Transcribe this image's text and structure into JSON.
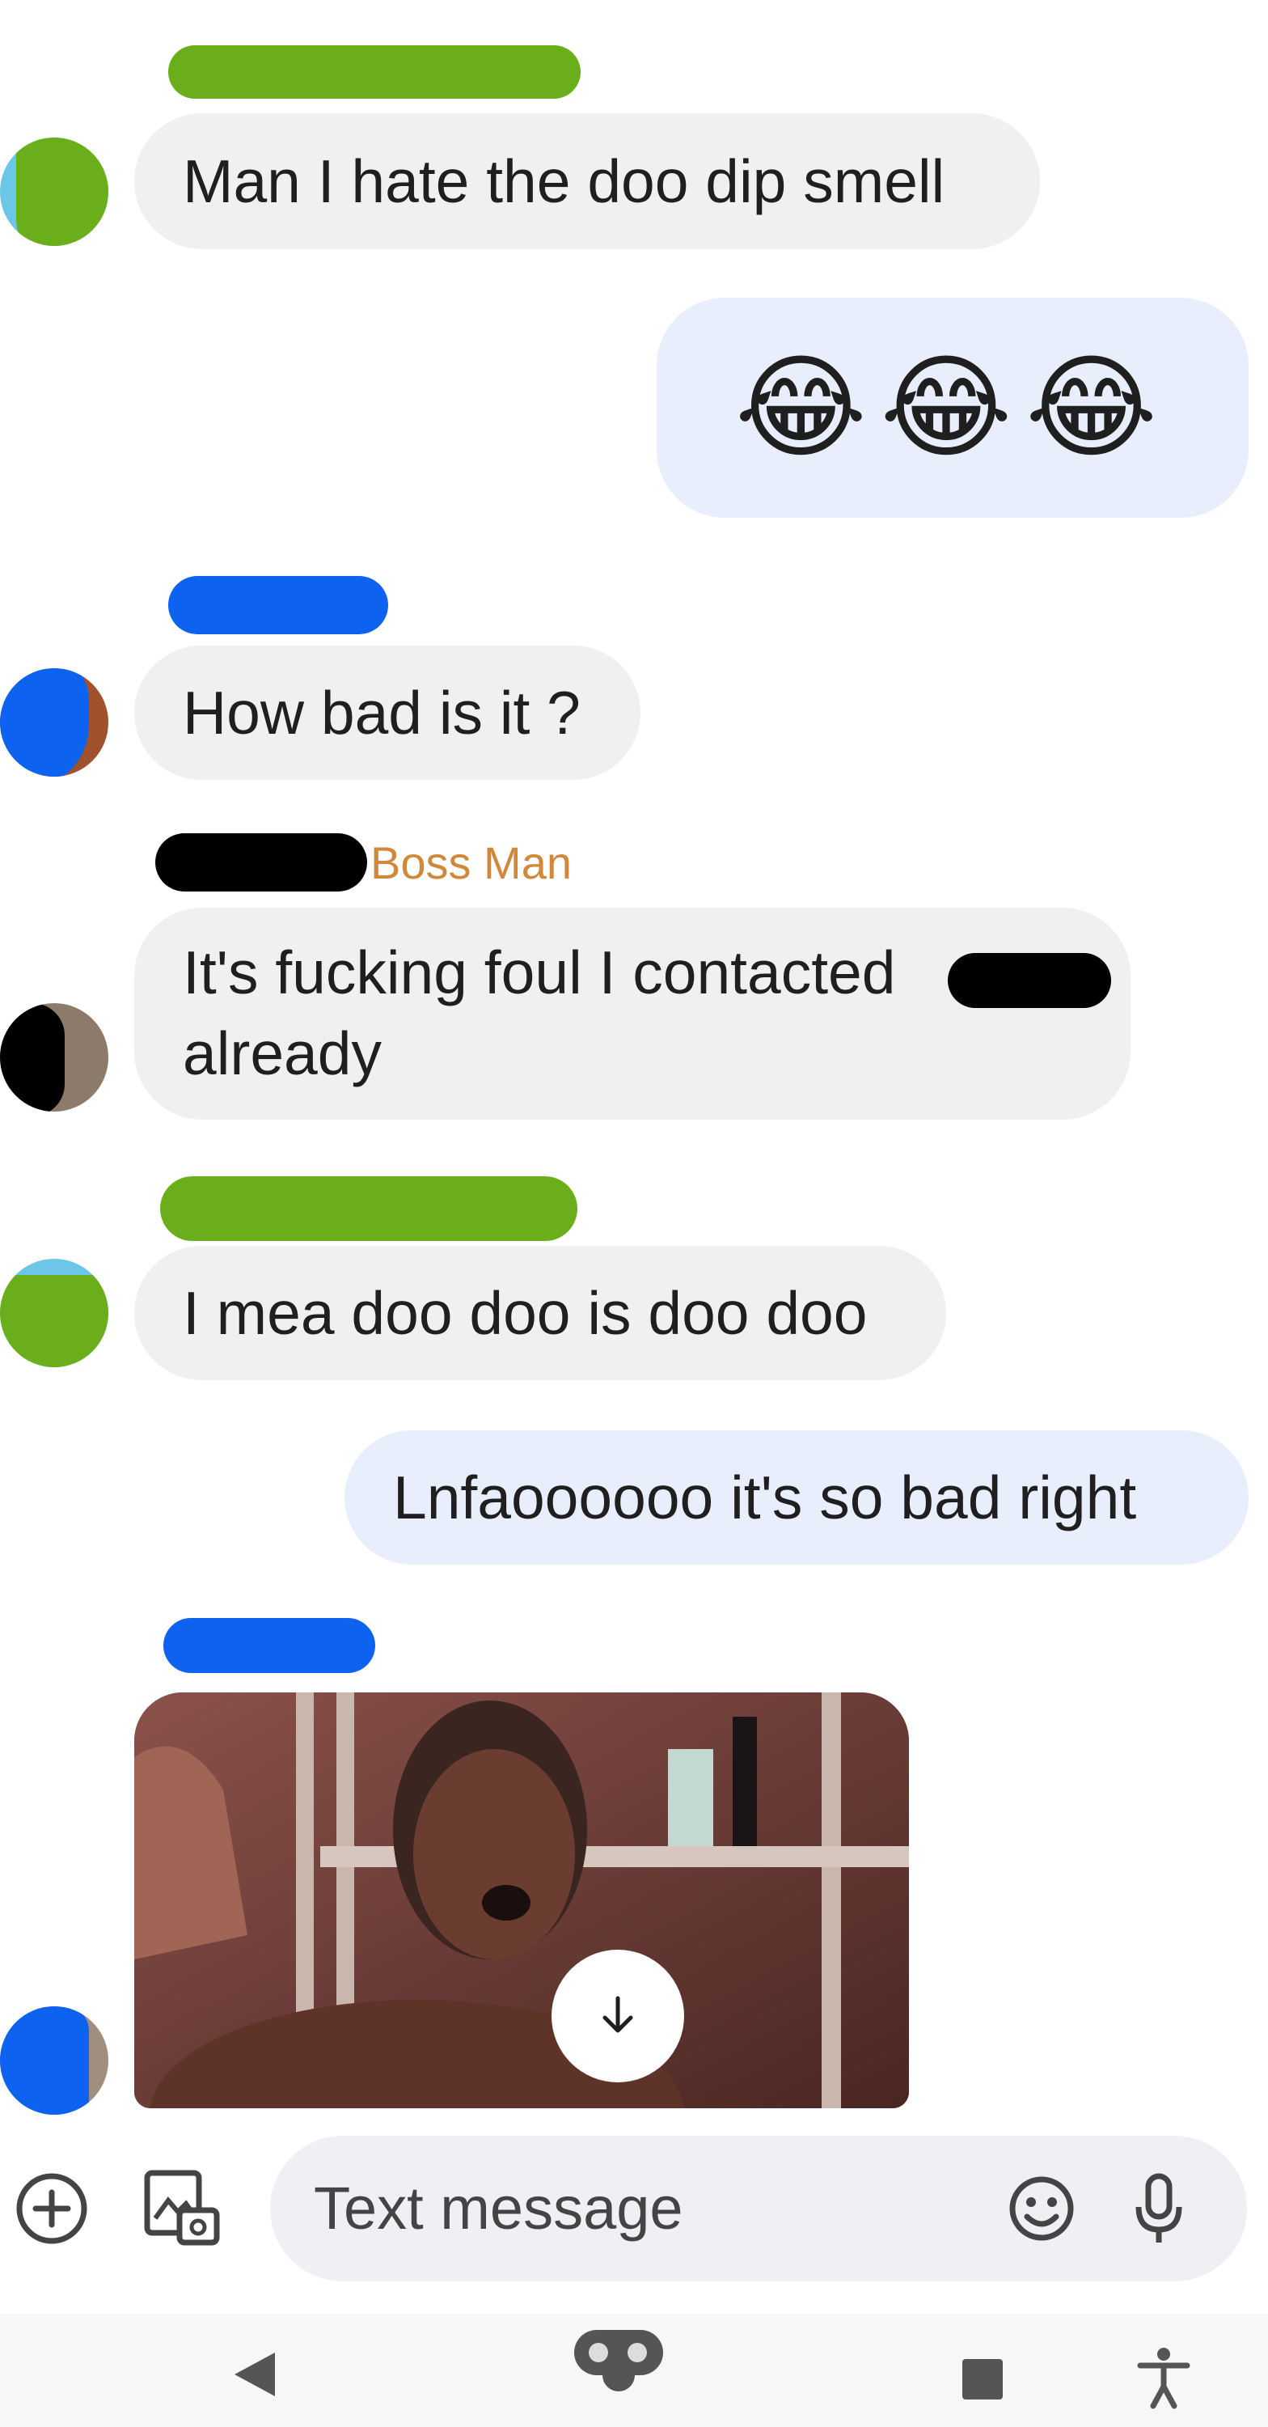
{
  "messages": [
    {
      "id": "m1",
      "direction": "incoming",
      "text": "Man I hate the doo dip smell"
    },
    {
      "id": "m2",
      "direction": "outgoing",
      "emoji": "😂😂😂"
    },
    {
      "id": "m3",
      "direction": "incoming",
      "text": "How bad is it ?"
    },
    {
      "id": "m4",
      "direction": "incoming",
      "sender_label": "Boss Man",
      "line1": "It's fucking foul I contacted",
      "line2": "already"
    },
    {
      "id": "m5",
      "direction": "incoming",
      "text": "I mea doo doo is doo doo"
    },
    {
      "id": "m6",
      "direction": "outgoing",
      "text": "Lnfaoooooo it's so bad right"
    },
    {
      "id": "m7",
      "direction": "incoming",
      "attachment": "gif-image"
    }
  ],
  "composer": {
    "placeholder": "Text message",
    "icons": {
      "add": "add-circle-icon",
      "gallery": "gallery-camera-icon",
      "emoji": "emoji-icon",
      "mic": "mic-icon"
    }
  },
  "navbar": {
    "icons": {
      "back": "back-triangle-icon",
      "home": "home-pill-icon",
      "recents": "recents-square-icon",
      "accessibility": "accessibility-icon"
    }
  },
  "colors": {
    "incoming_bubble": "#f0f0f3",
    "outgoing_bubble": "#e8eefb",
    "sender_label": "#d0883a",
    "redact_green": "#6aaf1b",
    "redact_blue": "#0d63f0"
  }
}
